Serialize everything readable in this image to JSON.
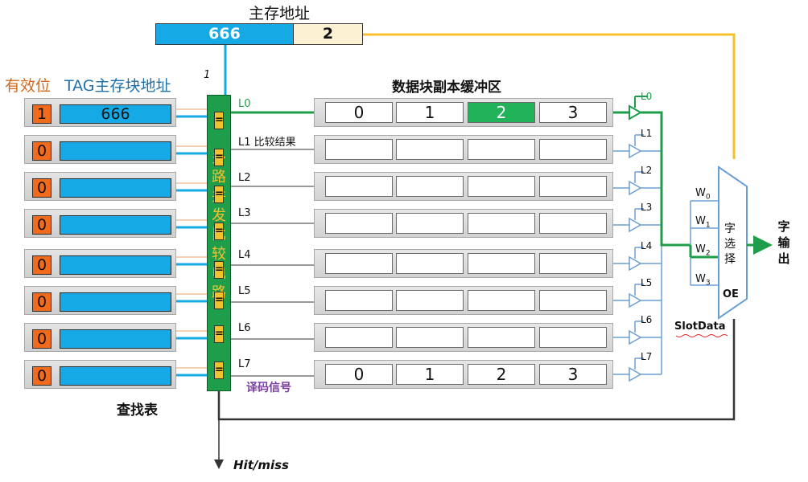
{
  "main_address": {
    "label": "主存地址",
    "block": "666",
    "offset": "2"
  },
  "header": {
    "valid_label": "有效位",
    "tag_label": "TAG主存块地址",
    "bit_marker": "1"
  },
  "lookup_table": {
    "title": "查找表",
    "rows": [
      {
        "valid": "1",
        "tag": "666"
      },
      {
        "valid": "0",
        "tag": ""
      },
      {
        "valid": "0",
        "tag": ""
      },
      {
        "valid": "0",
        "tag": ""
      },
      {
        "valid": "0",
        "tag": ""
      },
      {
        "valid": "0",
        "tag": ""
      },
      {
        "valid": "0",
        "tag": ""
      },
      {
        "valid": "0",
        "tag": ""
      }
    ]
  },
  "comparator": {
    "label": "多路并发比较电路",
    "symbol": "="
  },
  "lines": {
    "labels": [
      "L0",
      "L1 比较结果",
      "L2",
      "L3",
      "L4",
      "L5",
      "L6",
      "L7"
    ],
    "decode_label": "译码信号"
  },
  "buffer": {
    "title": "数据块副本缓冲区",
    "rows": [
      [
        "0",
        "1",
        "2",
        "3"
      ],
      [
        "",
        "",
        "",
        ""
      ],
      [
        "",
        "",
        "",
        ""
      ],
      [
        "",
        "",
        "",
        ""
      ],
      [
        "",
        "",
        "",
        ""
      ],
      [
        "",
        "",
        "",
        ""
      ],
      [
        "",
        "",
        "",
        ""
      ],
      [
        "0",
        "1",
        "2",
        "3"
      ]
    ],
    "highlight": {
      "row": 0,
      "col": 2
    }
  },
  "tristate_labels": [
    "L0",
    "L1",
    "L2",
    "L3",
    "L4",
    "L5",
    "L6",
    "L7"
  ],
  "word_select": {
    "inputs": [
      "W0",
      "W1",
      "W2",
      "W3"
    ],
    "label": "字选择",
    "oe": "OE",
    "slotdata": "SlotData",
    "output": "字输出"
  },
  "hitmiss": "Hit/miss",
  "colors": {
    "tag_blue": "#15a9e6",
    "valid_orange": "#f26b1d",
    "comparator_green": "#1e9e4a",
    "highlight_green": "#22b35a",
    "address_yellow": "#f6c02d",
    "line_blue": "#6a9fd6"
  }
}
